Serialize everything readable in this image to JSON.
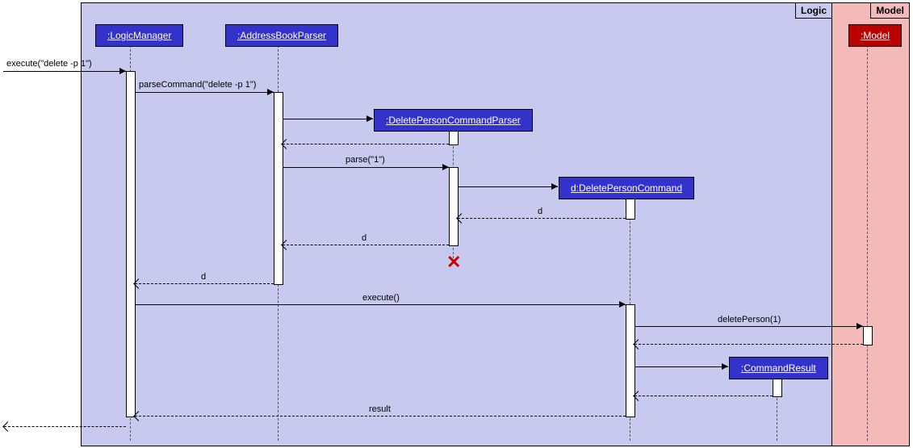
{
  "packages": {
    "logic": {
      "label": "Logic"
    },
    "model": {
      "label": "Model"
    }
  },
  "objects": {
    "logicManager": ":LogicManager",
    "addressBookParser": ":AddressBookParser",
    "deletePersonCommandParser": ":DeletePersonCommandParser",
    "deletePersonCommand": "d:DeletePersonCommand",
    "commandResult": ":CommandResult",
    "model": ":Model"
  },
  "messages": {
    "execute": "execute(\"delete -p 1\")",
    "parseCommand": "parseCommand(\"delete -p 1\")",
    "parse": "parse(\"1\")",
    "returnD1": "d",
    "returnD2": "d",
    "returnD3": "d",
    "executeEmpty": "execute()",
    "deletePerson": "deletePerson(1)",
    "result": "result"
  },
  "chart_data": {
    "type": "sequence_diagram",
    "packages": [
      {
        "name": "Logic",
        "contains": [
          "LogicManager",
          "AddressBookParser",
          "DeletePersonCommandParser",
          "d:DeletePersonCommand",
          "CommandResult"
        ]
      },
      {
        "name": "Model",
        "contains": [
          "Model"
        ]
      }
    ],
    "lifelines": [
      {
        "id": "LogicManager",
        "label": ":LogicManager"
      },
      {
        "id": "AddressBookParser",
        "label": ":AddressBookParser"
      },
      {
        "id": "DeletePersonCommandParser",
        "label": ":DeletePersonCommandParser",
        "created_by_msg": 2,
        "destroyed_after_msg": 6
      },
      {
        "id": "DeletePersonCommand",
        "label": "d:DeletePersonCommand",
        "created_by_msg": 4
      },
      {
        "id": "Model",
        "label": ":Model"
      },
      {
        "id": "CommandResult",
        "label": ":CommandResult",
        "created_by_msg": 11
      }
    ],
    "messages": [
      {
        "n": 1,
        "from": "external",
        "to": "LogicManager",
        "label": "execute(\"delete -p 1\")",
        "type": "sync"
      },
      {
        "n": 2,
        "from": "LogicManager",
        "to": "AddressBookParser",
        "label": "parseCommand(\"delete -p 1\")",
        "type": "sync"
      },
      {
        "n": 3,
        "from": "AddressBookParser",
        "to": "DeletePersonCommandParser",
        "label": "",
        "type": "create"
      },
      {
        "n": 4,
        "from": "DeletePersonCommandParser",
        "to": "AddressBookParser",
        "label": "",
        "type": "return"
      },
      {
        "n": 5,
        "from": "AddressBookParser",
        "to": "DeletePersonCommandParser",
        "label": "parse(\"1\")",
        "type": "sync"
      },
      {
        "n": 6,
        "from": "DeletePersonCommandParser",
        "to": "DeletePersonCommand",
        "label": "",
        "type": "create"
      },
      {
        "n": 7,
        "from": "DeletePersonCommand",
        "to": "DeletePersonCommandParser",
        "label": "d",
        "type": "return"
      },
      {
        "n": 8,
        "from": "DeletePersonCommandParser",
        "to": "AddressBookParser",
        "label": "d",
        "type": "return"
      },
      {
        "n": 9,
        "from": "AddressBookParser",
        "to": "LogicManager",
        "label": "d",
        "type": "return"
      },
      {
        "n": 10,
        "from": "LogicManager",
        "to": "DeletePersonCommand",
        "label": "execute()",
        "type": "sync"
      },
      {
        "n": 11,
        "from": "DeletePersonCommand",
        "to": "Model",
        "label": "deletePerson(1)",
        "type": "sync"
      },
      {
        "n": 12,
        "from": "Model",
        "to": "DeletePersonCommand",
        "label": "",
        "type": "return"
      },
      {
        "n": 13,
        "from": "DeletePersonCommand",
        "to": "CommandResult",
        "label": "",
        "type": "create"
      },
      {
        "n": 14,
        "from": "CommandResult",
        "to": "DeletePersonCommand",
        "label": "",
        "type": "return"
      },
      {
        "n": 15,
        "from": "DeletePersonCommand",
        "to": "LogicManager",
        "label": "result",
        "type": "return"
      },
      {
        "n": 16,
        "from": "LogicManager",
        "to": "external",
        "label": "",
        "type": "return"
      }
    ]
  }
}
